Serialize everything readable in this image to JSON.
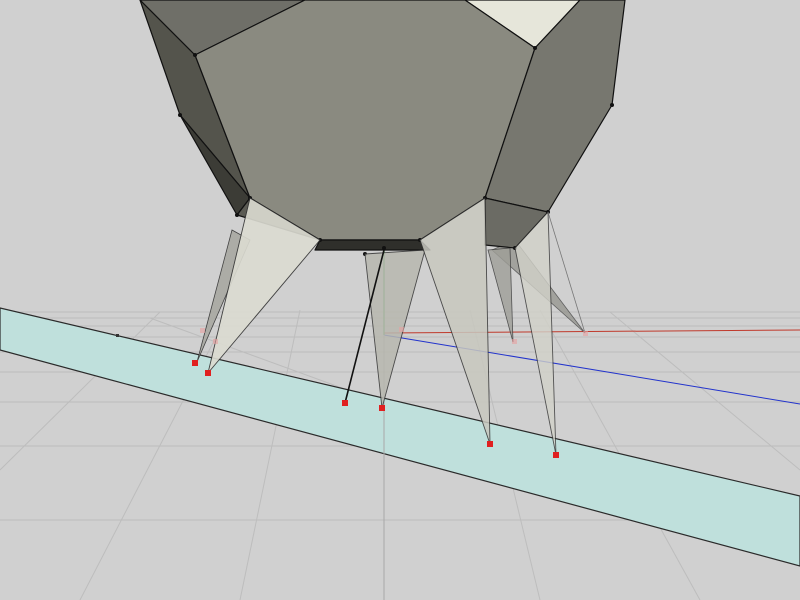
{
  "viewport": {
    "background": "#d0d0d0",
    "grid_color": "#bdbdbd",
    "grid_dark_color": "#9a9a9a"
  },
  "axes": {
    "x_color": "#c0392b",
    "y_color": "#2e9a2e",
    "z_color": "#2233cc"
  },
  "ground_plane": {
    "fill": "#bfe0dc",
    "edge_color": "#2a2a2a"
  },
  "model": {
    "face_colors": [
      "#8a8a80",
      "#54544c",
      "#77776f",
      "#e6e6da",
      "#444440"
    ],
    "spike_colors": [
      "#c8c8bf",
      "#a9a9a2",
      "#dcdcd2",
      "#8f8f88"
    ],
    "vertex_color": "#111111"
  },
  "handles": {
    "color": "#e02020"
  }
}
